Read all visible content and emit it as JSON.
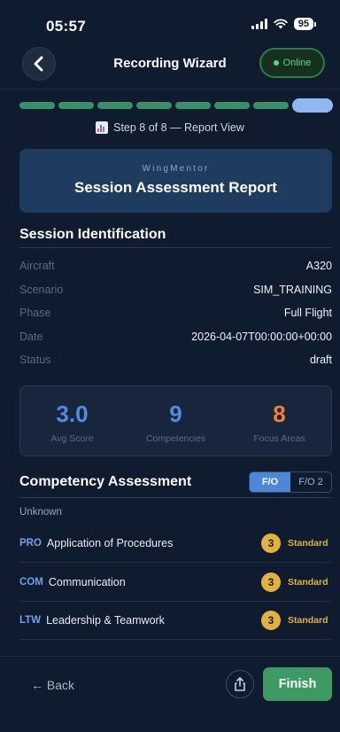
{
  "status_bar": {
    "time": "05:57",
    "battery": "95"
  },
  "header": {
    "title": "Recording Wizard",
    "status_label": "Online"
  },
  "progress": {
    "total_steps": 8,
    "current_step": 8,
    "label": "Step 8 of 8 — Report View"
  },
  "banner": {
    "brand": "WingMentor",
    "title": "Session Assessment Report"
  },
  "identification": {
    "title": "Session Identification",
    "rows": [
      {
        "key": "Aircraft",
        "value": "A320"
      },
      {
        "key": "Scenario",
        "value": "SIM_TRAINING"
      },
      {
        "key": "Phase",
        "value": "Full Flight"
      },
      {
        "key": "Date",
        "value": "2026-04-07T00:00:00+00:00"
      },
      {
        "key": "Status",
        "value": "draft"
      }
    ]
  },
  "stats": [
    {
      "value": "3.0",
      "label": "Avg Score",
      "color": "#4f8be3"
    },
    {
      "value": "9",
      "label": "Competencies",
      "color": "#4f8be3"
    },
    {
      "value": "8",
      "label": "Focus Areas",
      "color": "#ef7f3a"
    }
  ],
  "competency": {
    "title": "Competency Assessment",
    "tabs": [
      "F/O",
      "F/O 2"
    ],
    "selected_tab": "F/O",
    "group_label": "Unknown",
    "items": [
      {
        "code": "PRO",
        "name": "Application of Procedures",
        "score": "3",
        "grade": "Standard"
      },
      {
        "code": "COM",
        "name": "Communication",
        "score": "3",
        "grade": "Standard"
      },
      {
        "code": "LTW",
        "name": "Leadership & Teamwork",
        "score": "3",
        "grade": "Standard"
      }
    ]
  },
  "footer": {
    "back_label": "← Back",
    "finish_label": "Finish"
  },
  "colors": {
    "background": "#0f1b2e",
    "progress_done": "#3a8f66",
    "progress_active": "#8db8f2",
    "accent_blue": "#4c87d8",
    "grade_gold": "#e3b23c",
    "finish_green": "#3d9a63"
  }
}
